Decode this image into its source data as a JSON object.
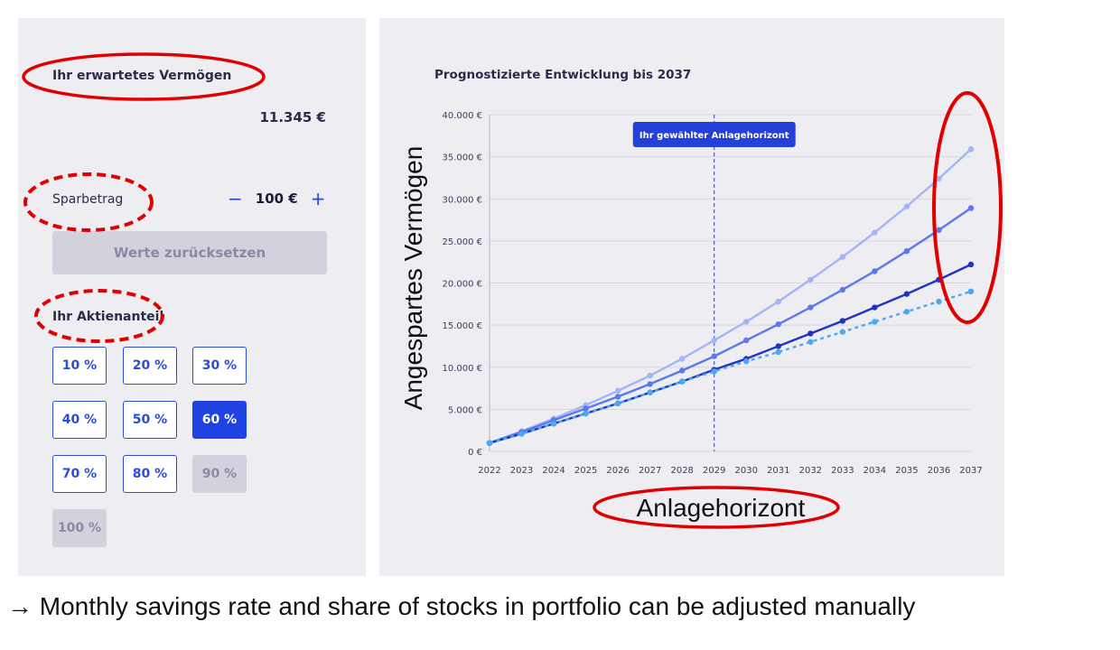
{
  "left_panel": {
    "expected_label": "Ihr erwartetes Vermögen",
    "expected_value": "11.345 €",
    "savings_label": "Sparbetrag",
    "savings_minus": "−",
    "savings_value": "100 €",
    "savings_plus": "+",
    "reset_label": "Werte zurücksetzen",
    "share_label": "Ihr Aktienanteil",
    "share_options": [
      "10 %",
      "20 %",
      "30 %",
      "40 %",
      "50 %",
      "60 %",
      "70 %",
      "80 %",
      "90 %",
      "100 %"
    ],
    "share_selected": "60 %",
    "share_disabled": [
      "90 %",
      "100 %"
    ]
  },
  "chart_panel": {
    "title": "Prognostizierte Entwicklung bis 2037",
    "horizon_tooltip": "Ihr gewählter Anlagehorizont"
  },
  "annotations": {
    "y_axis_label": "Angespartes Vermögen",
    "x_axis_label": "Anlagehorizont",
    "caption_arrow": "→",
    "caption": "Monthly savings rate and share of stocks in portfolio can be adjusted manually",
    "highlight_color": "#e00000"
  },
  "chart_data": {
    "type": "line",
    "title": "Prognostizierte Entwicklung bis 2037",
    "x": [
      2022,
      2023,
      2024,
      2025,
      2026,
      2027,
      2028,
      2029,
      2030,
      2031,
      2032,
      2033,
      2034,
      2035,
      2036,
      2037
    ],
    "x_tick_labels": [
      "2022",
      "2023",
      "2024",
      "2025",
      "2026",
      "2027",
      "2028",
      "2029",
      "2030",
      "2031",
      "2032",
      "2033",
      "2034",
      "2035",
      "2036",
      "2037"
    ],
    "ylim": [
      0,
      40000
    ],
    "y_ticks": [
      0,
      5000,
      10000,
      15000,
      20000,
      25000,
      30000,
      35000,
      40000
    ],
    "y_tick_labels": [
      "0 €",
      "5.000 €",
      "10.000 €",
      "15.000 €",
      "20.000 €",
      "25.000 €",
      "30.000 €",
      "35.000 €",
      "40.000 €"
    ],
    "grid": true,
    "vertical_marker_x": 2029,
    "series": [
      {
        "color": "#a5b4f7",
        "dashed": false,
        "values": [
          1000,
          2400,
          3900,
          5500,
          7200,
          9000,
          11000,
          13200,
          15400,
          17800,
          20400,
          23100,
          26000,
          29100,
          32400,
          35900
        ]
      },
      {
        "color": "#5b78ec",
        "dashed": false,
        "values": [
          1000,
          2300,
          3700,
          5100,
          6500,
          8000,
          9600,
          11300,
          13200,
          15100,
          17100,
          19200,
          21400,
          23800,
          26300,
          28900
        ]
      },
      {
        "color": "#1f34c4",
        "dashed": false,
        "values": [
          1000,
          2100,
          3300,
          4500,
          5700,
          7000,
          8300,
          9700,
          11000,
          12500,
          14000,
          15500,
          17100,
          18700,
          20400,
          22200
        ]
      },
      {
        "color": "#4aa9f0",
        "dashed": true,
        "values": [
          1000,
          2100,
          3300,
          4500,
          5700,
          7000,
          8300,
          9500,
          10700,
          11800,
          13000,
          14200,
          15400,
          16600,
          17800,
          19000
        ]
      }
    ]
  }
}
